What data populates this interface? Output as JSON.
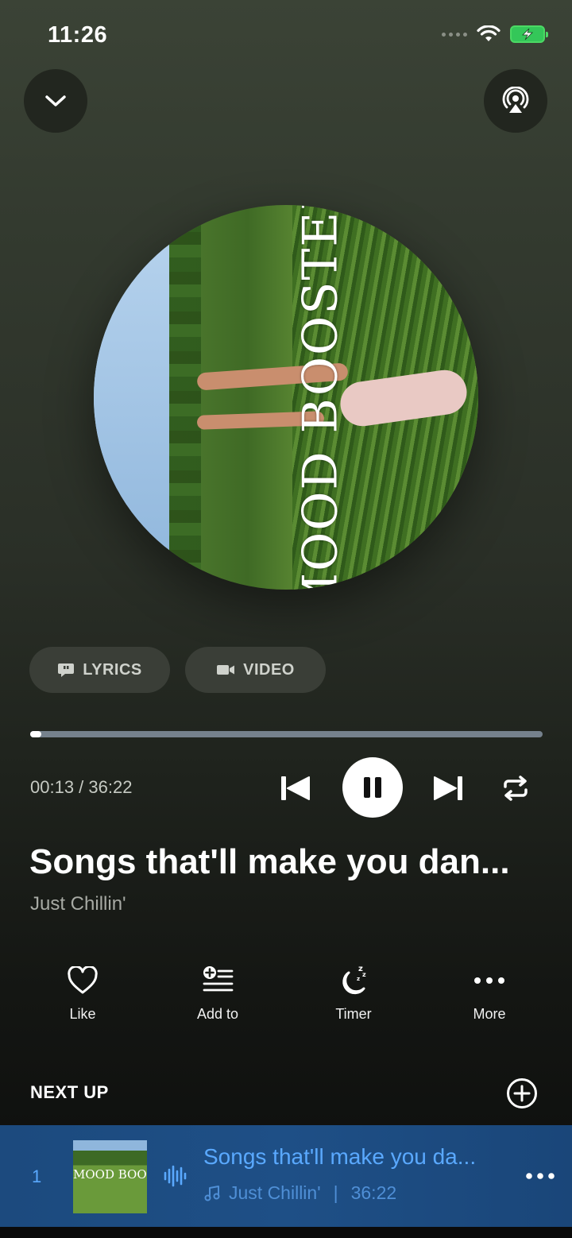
{
  "status_bar": {
    "time": "11:26"
  },
  "artwork": {
    "text": "MOOD BOOSTER"
  },
  "chips": {
    "lyrics": "LYRICS",
    "video": "VIDEO"
  },
  "player": {
    "elapsed_time": "00:13 / 36:22",
    "progress_fraction": 0.006,
    "title": "Songs that'll make you dan...",
    "artist": "Just Chillin'"
  },
  "actions": {
    "like": "Like",
    "add_to": "Add to",
    "timer": "Timer",
    "more": "More"
  },
  "next_up": {
    "header": "NEXT UP",
    "items": [
      {
        "index": "1",
        "thumb_text": "MOOD BOOSTER",
        "title": "Songs that'll make you da...",
        "artist": "Just Chillin'",
        "separator": "|",
        "duration": "36:22"
      }
    ]
  },
  "colors": {
    "accent_blue": "#5aa9ff",
    "queue_row_bg": "#1e4f86",
    "battery": "#34c759"
  }
}
